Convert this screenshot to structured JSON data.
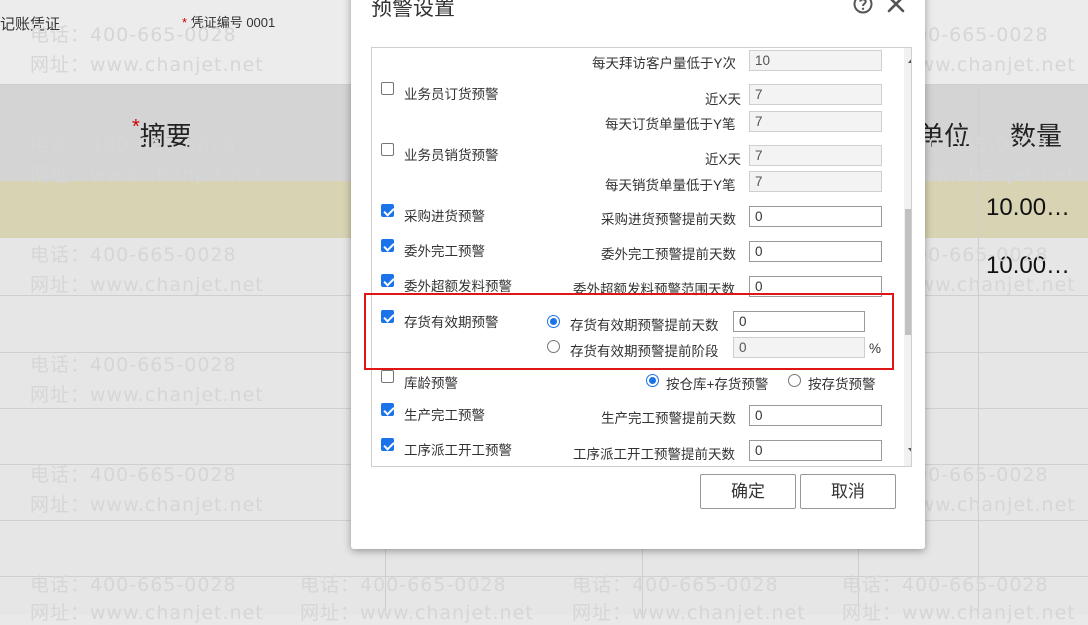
{
  "background": {
    "top_labels": {
      "voucher_type": "记账凭证",
      "voucher_no_label": "凭证编号",
      "voucher_no_value": "0001",
      "required_mark": "*"
    },
    "columns": {
      "summary": "摘要",
      "unit": "单位",
      "quantity": "数量"
    },
    "rows": [
      {
        "quantity": "10.00…"
      },
      {
        "quantity": "10.00…"
      }
    ],
    "watermark": {
      "phone": "电话：400-665-0028",
      "site": "网址：www.chanjet.net"
    }
  },
  "dialog": {
    "title": "预警设置",
    "rows": {
      "visit": {
        "label": "每天拜访客户量低于Y次",
        "value": "10"
      },
      "order": {
        "label": "业务员订货预警",
        "checked": false,
        "x_label": "近X天",
        "x_value": "7",
        "y_label": "每天订货单量低于Y笔",
        "y_value": "7"
      },
      "sales": {
        "label": "业务员销货预警",
        "checked": false,
        "x_label": "近X天",
        "x_value": "7",
        "y_label": "每天销货单量低于Y笔",
        "y_value": "7"
      },
      "purchase": {
        "label": "采购进货预警",
        "checked": true,
        "field_label": "采购进货预警提前天数",
        "value": "0"
      },
      "outsource_done": {
        "label": "委外完工预警",
        "checked": true,
        "field_label": "委外完工预警提前天数",
        "value": "0"
      },
      "outsource_excess": {
        "label": "委外超额发料预警",
        "checked": true,
        "field_label": "委外超额发料预警范围天数",
        "value": "0"
      },
      "shelf_life": {
        "label": "存货有效期预警",
        "checked": true,
        "opt1_label": "存货有效期预警提前天数",
        "opt1_value": "0",
        "opt1_selected": true,
        "opt2_label": "存货有效期预警提前阶段",
        "opt2_value": "0",
        "opt2_unit": "%",
        "opt2_selected": false
      },
      "stock_age": {
        "label": "库龄预警",
        "checked": false,
        "opt1_label": "按仓库+存货预警",
        "opt1_selected": true,
        "opt2_label": "按存货预警",
        "opt2_selected": false
      },
      "production": {
        "label": "生产完工预警",
        "checked": true,
        "field_label": "生产完工预警提前天数",
        "value": "0"
      },
      "process": {
        "label": "工序派工开工预警",
        "checked": true,
        "field_label": "工序派工开工预警提前天数",
        "value": "0"
      }
    },
    "buttons": {
      "ok": "确定",
      "cancel": "取消"
    }
  }
}
